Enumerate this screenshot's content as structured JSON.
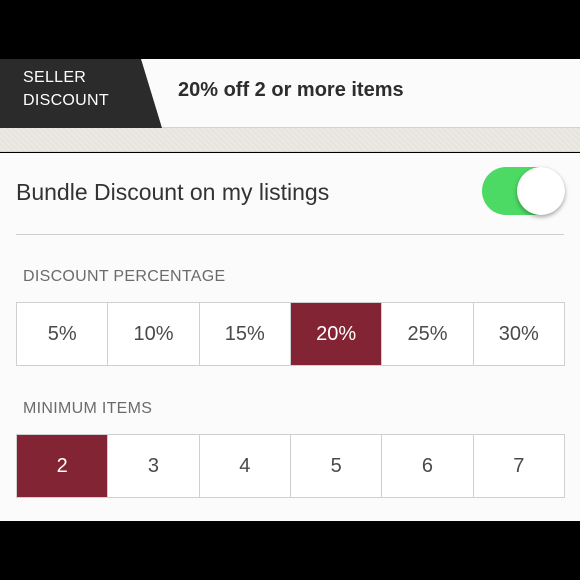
{
  "banner": {
    "tag_line1": "SELLER",
    "tag_line2": "DISCOUNT",
    "title": "20% off 2 or more items"
  },
  "bundle": {
    "label": "Bundle Discount on my listings",
    "toggle_on": true
  },
  "discount": {
    "heading": "DISCOUNT PERCENTAGE",
    "options": [
      "5%",
      "10%",
      "15%",
      "20%",
      "25%",
      "30%"
    ],
    "selected": "20%"
  },
  "minimum": {
    "heading": "MINIMUM ITEMS",
    "options": [
      "2",
      "3",
      "4",
      "5",
      "6",
      "7"
    ],
    "selected": "2"
  },
  "colors": {
    "selected": "#822433",
    "toggle_on": "#4cd964",
    "tag_bg": "#2b2b2b"
  }
}
